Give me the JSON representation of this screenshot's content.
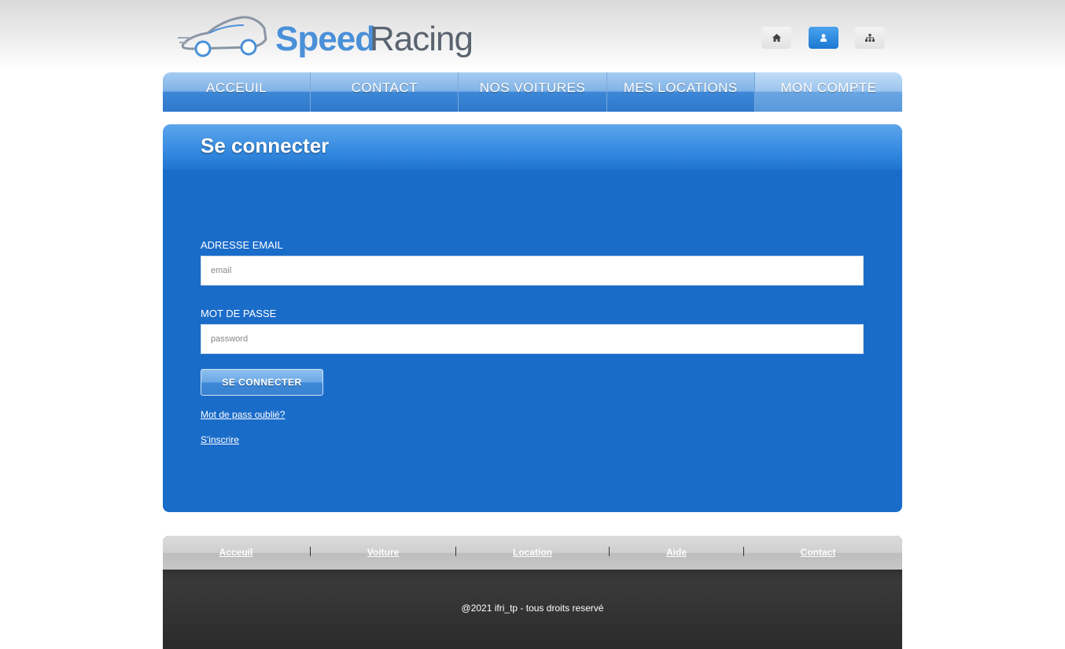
{
  "logo": {
    "speed": "Speed",
    "racing": "Racing"
  },
  "top_icons": [
    "home-icon",
    "user-icon",
    "sitemap-icon"
  ],
  "nav": {
    "items": [
      {
        "label": "ACCEUIL"
      },
      {
        "label": "CONTACT"
      },
      {
        "label": "NOS VOITURES"
      },
      {
        "label": "MES LOCATIONS"
      },
      {
        "label": "MON COMPTE"
      }
    ]
  },
  "login": {
    "title": "Se connecter",
    "email_label": "ADRESSE EMAIL",
    "email_placeholder": "email",
    "password_label": "MOT DE PASSE",
    "password_placeholder": "password",
    "submit_label": "SE CONNECTER",
    "forgot_link": "Mot de pass oublié?",
    "register_link": "S'inscrire"
  },
  "footer": {
    "links": [
      {
        "label": "Acceuil"
      },
      {
        "label": "Voiture"
      },
      {
        "label": "Location"
      },
      {
        "label": "Aide"
      },
      {
        "label": "Contact"
      }
    ],
    "copyright": "@2021 ifri_tp - tous droits reservé"
  },
  "colors": {
    "accent": "#1a6cc9",
    "active_icon": "#1c78d3"
  }
}
